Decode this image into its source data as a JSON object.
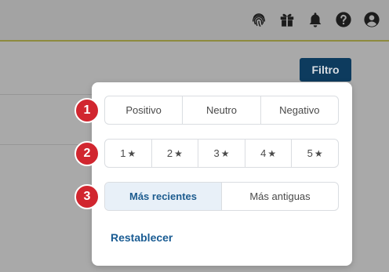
{
  "topbar": {
    "icons": [
      "fingerprint-icon",
      "gift-icon",
      "bell-icon",
      "help-icon",
      "account-icon"
    ]
  },
  "toolbar": {
    "filter_label": "Filtro"
  },
  "panel": {
    "steps": [
      "1",
      "2",
      "3"
    ],
    "sentiment": [
      "Positivo",
      "Neutro",
      "Negativo"
    ],
    "ratings": [
      "1",
      "2",
      "3",
      "4",
      "5"
    ],
    "star_glyph": "★",
    "sort": {
      "options": [
        "Más recientes",
        "Más antiguas"
      ],
      "selected": "Más recientes"
    },
    "reset_label": "Restablecer"
  },
  "colors": {
    "step_badge": "#d1262f",
    "accent": "#1a5c93",
    "filter_button": "#0d3b5e",
    "selected_bg": "#e8f0f8"
  }
}
